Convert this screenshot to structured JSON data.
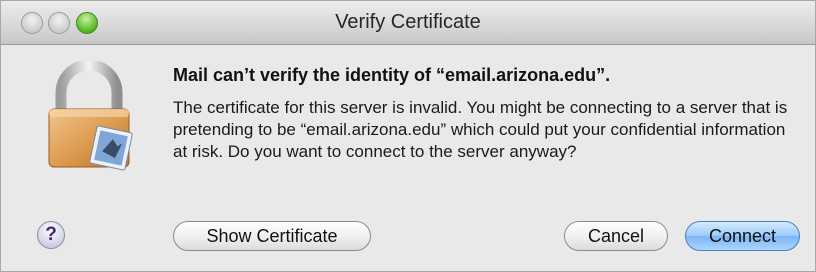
{
  "window": {
    "title": "Verify Certificate"
  },
  "dialog": {
    "headline": "Mail can’t verify the identity of “email.arizona.edu”.",
    "message": "The certificate for this server is invalid. You might be connecting to a server that is pretending to be “email.arizona.edu” which could put your confidential information at risk. Do you want to connect to the server anyway?"
  },
  "buttons": {
    "help": "?",
    "show_certificate": "Show Certificate",
    "cancel": "Cancel",
    "connect": "Connect"
  },
  "icons": {
    "lock": "padlock-icon",
    "mail_badge": "mail-stamp-icon"
  },
  "colors": {
    "default_button": "#8fc3f8",
    "zoom_button": "#5fbf2e"
  }
}
